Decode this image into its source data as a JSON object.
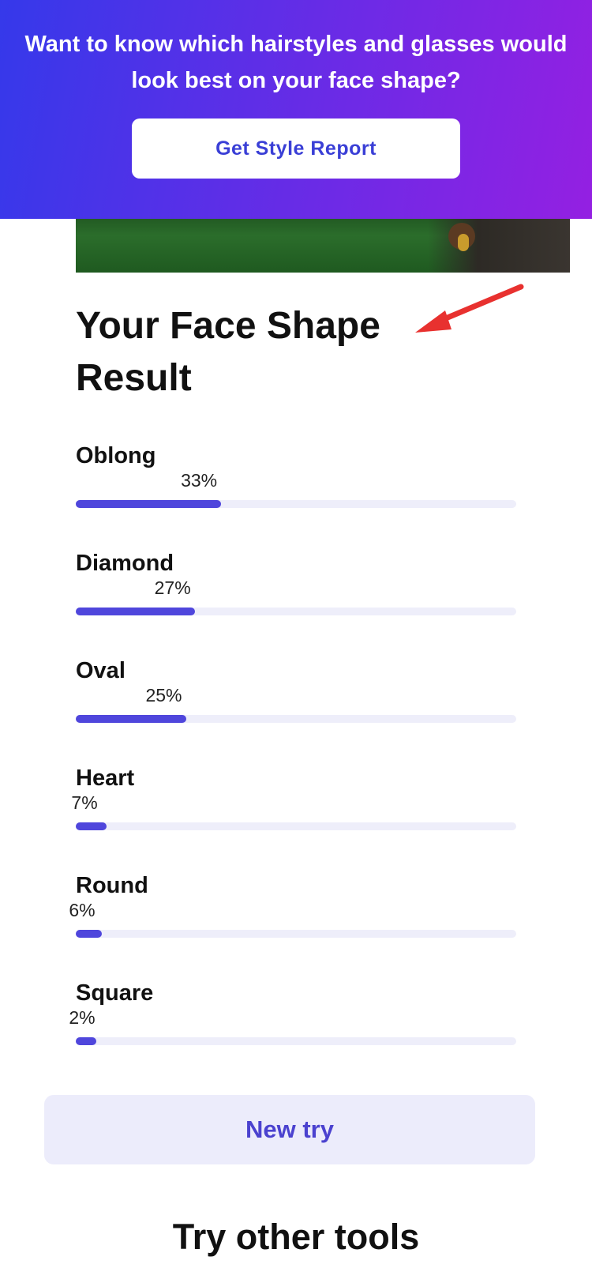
{
  "banner": {
    "text": "Want to know which hairstyles and glasses would look best on your face shape?",
    "button_label": "Get Style Report"
  },
  "result": {
    "title": "Your Face Shape Result",
    "items": [
      {
        "label": "Oblong",
        "percent_text": "33%",
        "value": 33
      },
      {
        "label": "Diamond",
        "percent_text": "27%",
        "value": 27
      },
      {
        "label": "Oval",
        "percent_text": "25%",
        "value": 25
      },
      {
        "label": "Heart",
        "percent_text": "7%",
        "value": 7
      },
      {
        "label": "Round",
        "percent_text": "6%",
        "value": 6
      },
      {
        "label": "Square",
        "percent_text": "2%",
        "value": 2
      }
    ]
  },
  "actions": {
    "new_try_label": "New try"
  },
  "tools": {
    "heading": "Try other tools"
  },
  "colors": {
    "accent": "#4f46dc",
    "track": "#eeeefa",
    "banner_start": "#3539ea",
    "banner_end": "#9420e2",
    "annotation_arrow": "#e8312f"
  }
}
